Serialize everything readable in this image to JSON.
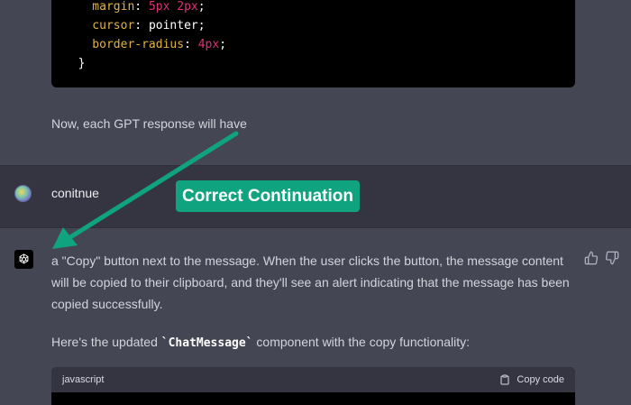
{
  "code_top": {
    "lines": [
      [
        {
          "t": "    margin",
          "c": "prop"
        },
        {
          "t": ": ",
          "c": "pun"
        },
        {
          "t": "5px 2px",
          "c": "num"
        },
        {
          "t": ";",
          "c": "pun"
        }
      ],
      [
        {
          "t": "    cursor",
          "c": "prop"
        },
        {
          "t": ": ",
          "c": "pun"
        },
        {
          "t": "pointer",
          "c": "txt"
        },
        {
          "t": ";",
          "c": "pun"
        }
      ],
      [
        {
          "t": "    border-radius",
          "c": "prop"
        },
        {
          "t": ": ",
          "c": "pun"
        },
        {
          "t": "4px",
          "c": "num"
        },
        {
          "t": ";",
          "c": "pun"
        }
      ],
      [
        {
          "t": "  }",
          "c": "pun"
        }
      ]
    ]
  },
  "top_message": "Now, each GPT response will have",
  "user_message": "conitnue",
  "annotation": {
    "label": "Correct Continuation",
    "color": "#10a37f"
  },
  "answer": {
    "paragraph": "a \"Copy\" button next to the message. When the user clicks the button, the message content will be copied to their clipboard, and they'll see an alert indicating that the message has been copied successfully.",
    "intro_before": "Here's the updated ",
    "intro_code": "`ChatMessage`",
    "intro_after": " component with the copy functionality:"
  },
  "code_block": {
    "language": "javascript",
    "copy_label": "Copy code"
  },
  "icons": {
    "avatar": "user-avatar",
    "assistant": "openai-logo-icon",
    "thumb_up": "thumbs-up-icon",
    "thumb_down": "thumbs-down-icon",
    "clipboard": "clipboard-icon"
  }
}
